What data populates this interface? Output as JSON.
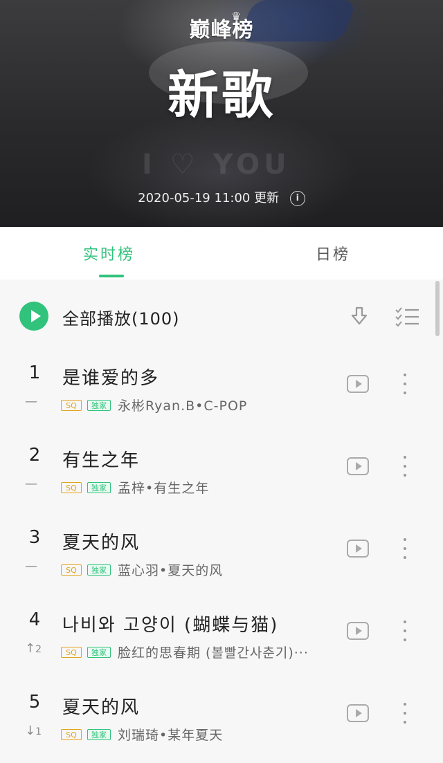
{
  "header": {
    "brand": "巅峰榜",
    "title": "新歌",
    "update_time": "2020-05-19 11:00",
    "update_label": "更新",
    "info_glyph": "i"
  },
  "tabs": [
    {
      "label": "实时榜",
      "active": true
    },
    {
      "label": "日榜",
      "active": false
    }
  ],
  "play_all": {
    "label": "全部播放(100)"
  },
  "songs": [
    {
      "rank": "1",
      "trend": "—",
      "trend_num": "",
      "title": "是谁爱的多",
      "meta": "永彬Ryan.B•C-POP",
      "sq": "SQ",
      "exclusive": "独家"
    },
    {
      "rank": "2",
      "trend": "—",
      "trend_num": "",
      "title": "有生之年",
      "meta": "孟梓•有生之年",
      "sq": "SQ",
      "exclusive": "独家"
    },
    {
      "rank": "3",
      "trend": "—",
      "trend_num": "",
      "title": "夏天的风",
      "meta": "蓝心羽•夏天的风",
      "sq": "SQ",
      "exclusive": "独家"
    },
    {
      "rank": "4",
      "trend": "↑",
      "trend_num": "2",
      "title": "나비와 고양이 (蝴蝶与猫)",
      "meta": "脸红的思春期 (볼빨간사춘기)···",
      "sq": "SQ",
      "exclusive": "独家"
    },
    {
      "rank": "5",
      "trend": "↓",
      "trend_num": "1",
      "title": "夏天的风",
      "meta": "刘瑞琦•某年夏天",
      "sq": "SQ",
      "exclusive": "独家"
    }
  ],
  "colors": {
    "accent": "#31c27c",
    "sq_badge": "#e3a31c"
  },
  "icons": [
    "info-icon",
    "play-all-icon",
    "download-icon",
    "multi-select-icon",
    "mv-play-icon",
    "more-icon"
  ]
}
